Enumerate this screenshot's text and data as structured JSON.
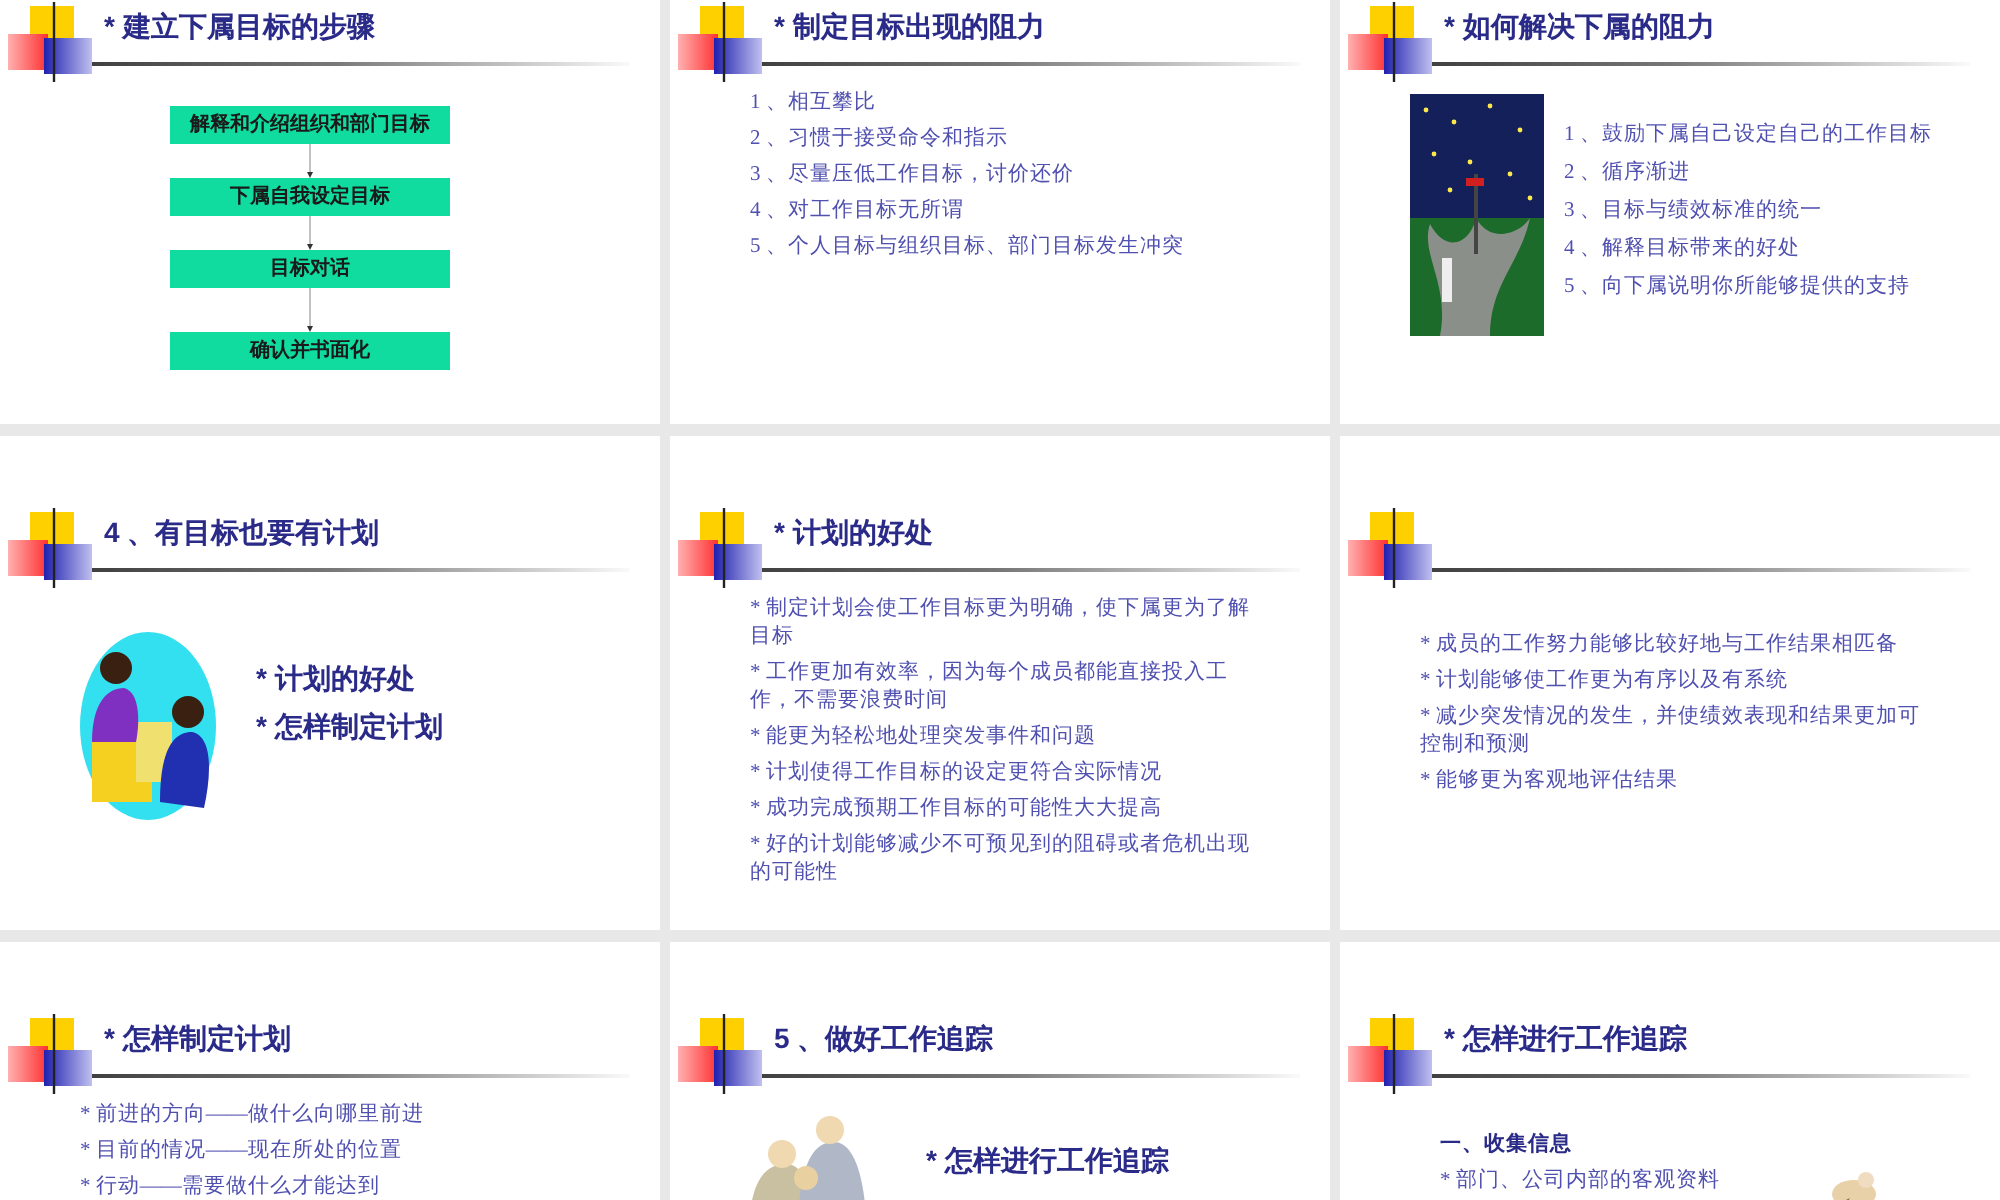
{
  "slides": [
    {
      "kind": "steps",
      "title": "* 建立下属目标的步骤",
      "steps": [
        "解释和介绍组织和部门目标",
        "下属自我设定目标",
        "目标对话",
        "确认并书面化"
      ]
    },
    {
      "kind": "list",
      "title": "* 制定目标出现的阻力",
      "items": [
        "1 、相互攀比",
        "2 、习惯于接受命令和指示",
        "3 、尽量压低工作目标，讨价还价",
        "4 、对工作目标无所谓",
        "5 、个人目标与组织目标、部门目标发生冲突"
      ]
    },
    {
      "kind": "picture-list",
      "title": "* 如何解决下属的阻力",
      "items": [
        "1 、鼓励下属自己设定自己的工作目标",
        "2 、循序渐进",
        "3 、目标与绩效标准的统一",
        "4 、解释目标带来的好处",
        "5 、向下属说明你所能够提供的支持"
      ]
    },
    {
      "kind": "picture-points",
      "title": "4 、有目标也要有计划",
      "items": [
        "* 计划的好处",
        "* 怎样制定计划"
      ]
    },
    {
      "kind": "list",
      "title": "* 计划的好处",
      "items": [
        "* 制定计划会使工作目标更为明确，使下属更为了解目标",
        "* 工作更加有效率，因为每个成员都能直接投入工作，不需要浪费时间",
        "* 能更为轻松地处理突发事件和问题",
        "* 计划使得工作目标的设定更符合实际情况",
        "* 成功完成预期工作目标的可能性大大提高",
        "* 好的计划能够减少不可预见到的阻碍或者危机出现的可能性"
      ]
    },
    {
      "kind": "list",
      "items": [
        "* 成员的工作努力能够比较好地与工作结果相匹备",
        "* 计划能够使工作更为有序以及有系统",
        "* 减少突发情况的发生，并使绩效表现和结果更加可控制和预测",
        "* 能够更为客观地评估结果"
      ]
    },
    {
      "kind": "list",
      "title": "* 怎样制定计划",
      "items": [
        "* 前进的方向——做什么向哪里前进",
        "* 目前的情况——现在所处的位置",
        "* 行动——需要做什么才能达到"
      ]
    },
    {
      "kind": "picture-points",
      "title": "5 、做好工作追踪",
      "items": [
        "* 怎样进行工作追踪"
      ]
    },
    {
      "kind": "notes",
      "title": "* 怎样进行工作追踪",
      "heading": "一、收集信息",
      "items": [
        "* 部门、公司内部的客观资料"
      ]
    }
  ]
}
